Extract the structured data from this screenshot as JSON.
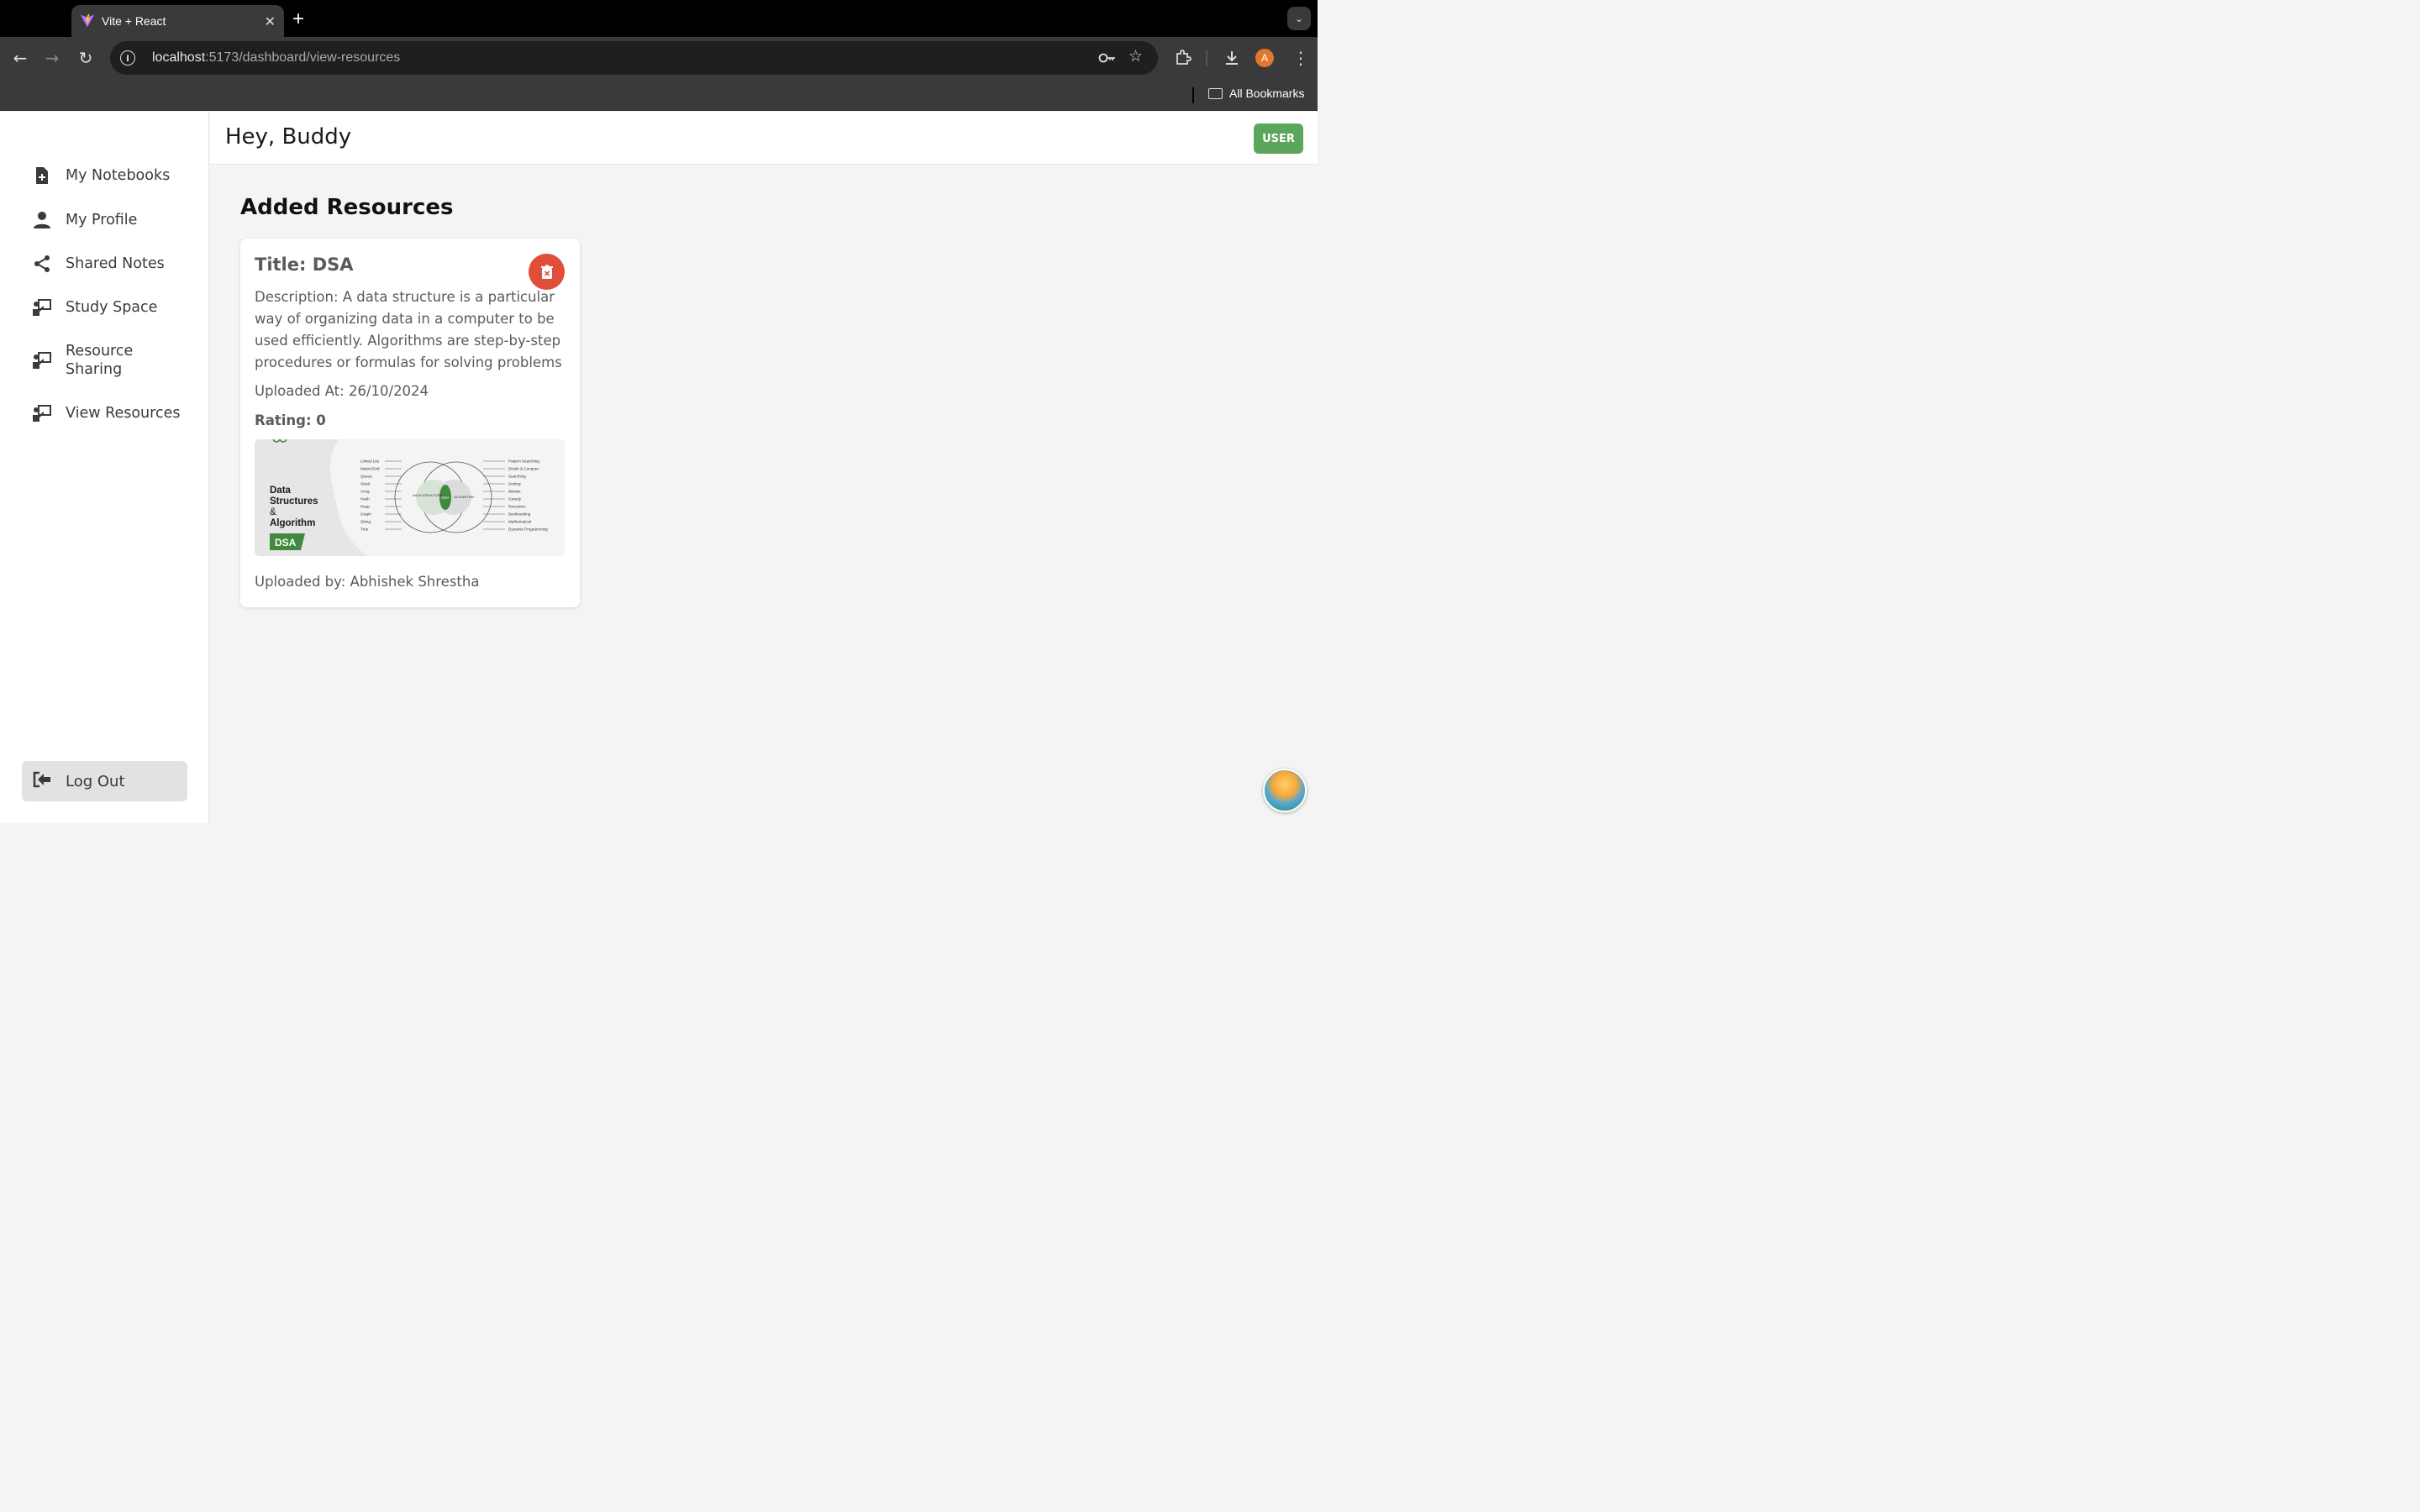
{
  "browser": {
    "tab_title": "Vite + React",
    "tab_close": "✕",
    "new_tab": "+",
    "url_host": "localhost",
    "url_path": ":5173/dashboard/view-resources",
    "profile_initial": "A",
    "bookmarks_label": "All Bookmarks"
  },
  "sidebar": {
    "items": [
      {
        "label": "My Notebooks",
        "icon": "add-file-icon"
      },
      {
        "label": "My Profile",
        "icon": "person-icon"
      },
      {
        "label": "Shared Notes",
        "icon": "share-icon"
      },
      {
        "label": "Study Space",
        "icon": "teacher-icon"
      },
      {
        "label": "Resource Sharing",
        "icon": "teacher-icon"
      },
      {
        "label": "View Resources",
        "icon": "teacher-icon"
      }
    ],
    "logout_label": "Log Out"
  },
  "header": {
    "greeting": "Hey, Buddy",
    "user_button": "USER"
  },
  "main": {
    "section_title": "Added Resources",
    "card": {
      "title": "Title: DSA",
      "description": "Description: A data structure is a particular way of organizing data in a computer to be used efficiently. Algorithms are step-by-step procedures or formulas for solving problems",
      "uploaded_at": "Uploaded At: 26/10/2024",
      "rating": "Rating: 0",
      "uploaded_by": "Uploaded by: Abhishek Shrestha",
      "image": {
        "heading_line1": "Data",
        "heading_line2": "Structures",
        "heading_line3": "&",
        "heading_line4": "Algorithm",
        "badge": "DSA",
        "left_list": [
          "Linked List",
          "Matrix/Grid",
          "Queue",
          "Stack",
          "Array",
          "Hash",
          "Heap",
          "Graph",
          "String",
          "Tree"
        ],
        "right_list": [
          "Pattern Searching",
          "Divide & Conquer",
          "Searching",
          "Sorting",
          "Bitwise",
          "Greedy",
          "Recursion",
          "Backtracking",
          "Mathematical",
          "Dynamic Programming"
        ],
        "circle_left": "DATA STRUCTURE",
        "circle_right": "ALGORITHM",
        "center": "DSA"
      }
    }
  },
  "colors": {
    "user_button": "#5ca55c",
    "delete_button": "#e04e3a",
    "badge_green": "#3f8a3f"
  }
}
